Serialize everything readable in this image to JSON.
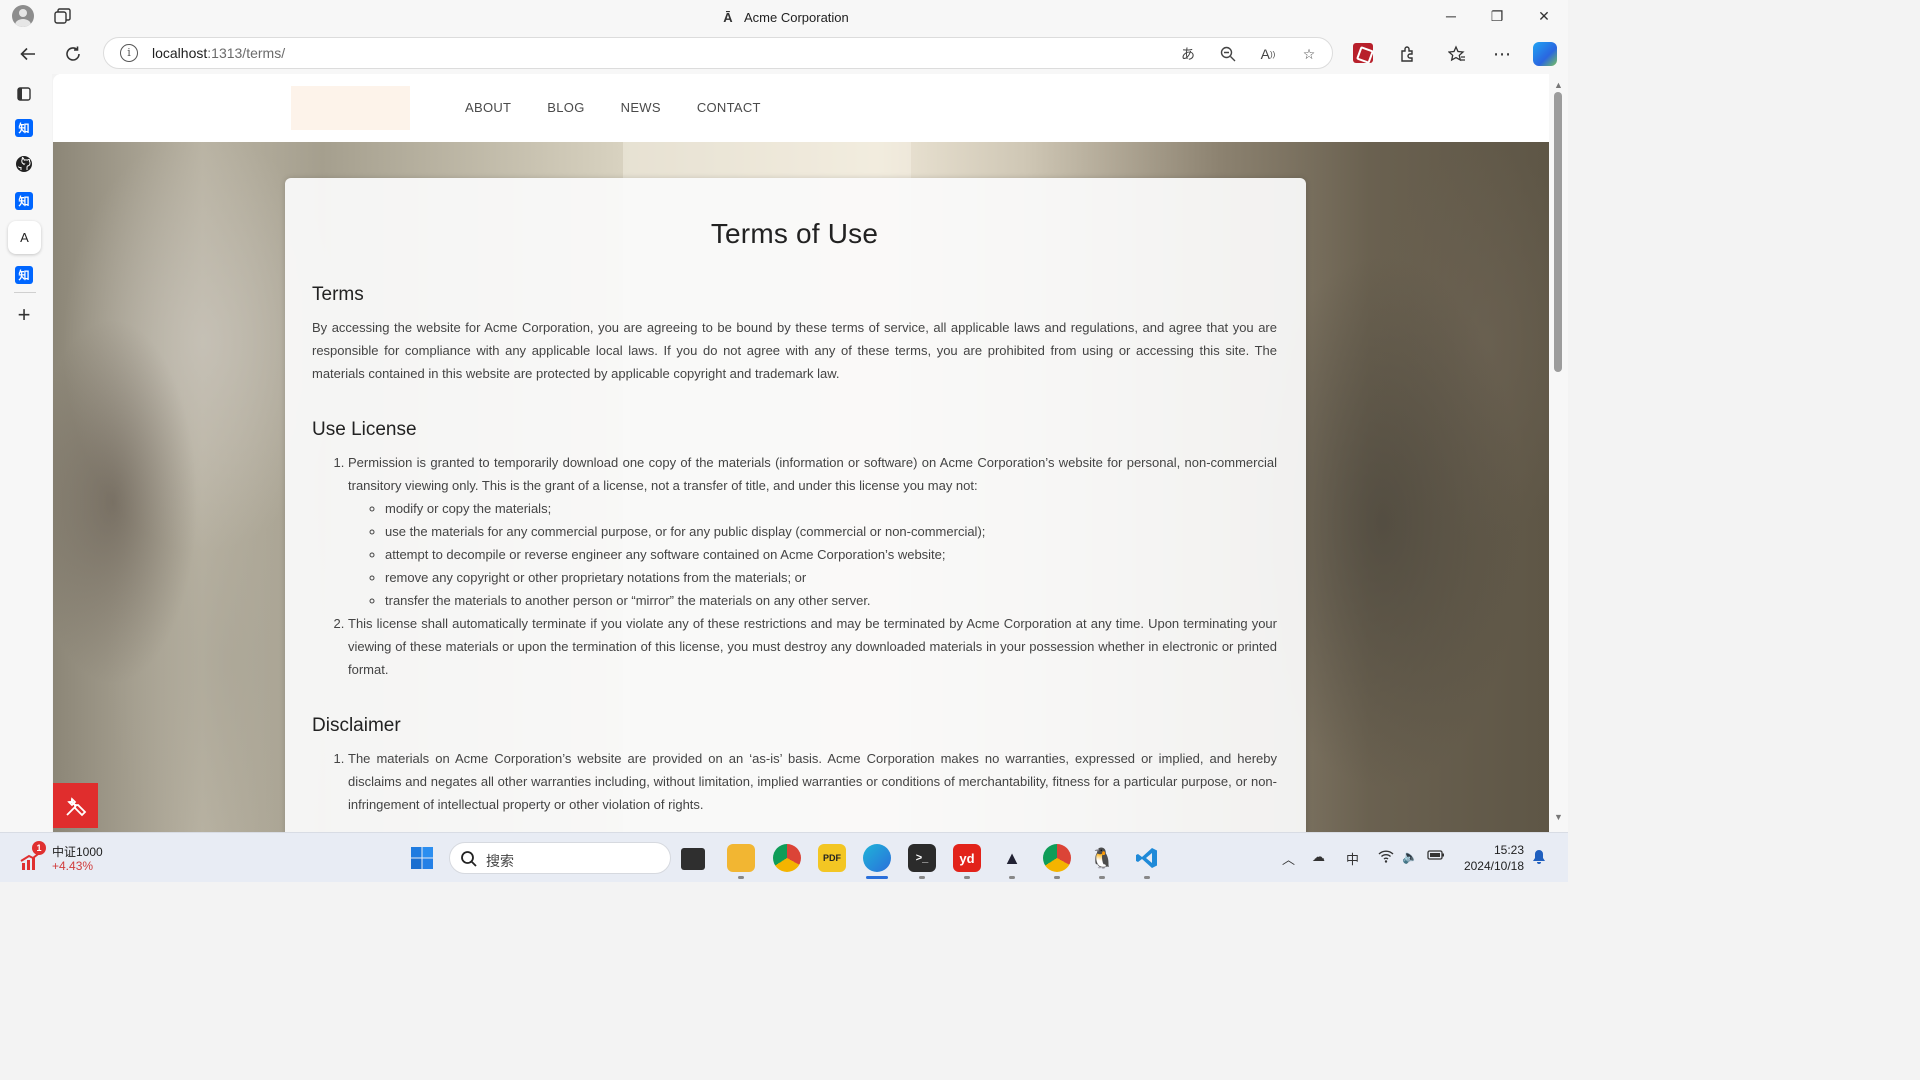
{
  "window": {
    "title": "Acme Corporation",
    "minimize_glyph": "─",
    "restore_glyph": "❐",
    "close_glyph": "✕"
  },
  "address_bar": {
    "host": "localhost",
    "path": ":1313/terms/"
  },
  "sidebar": {
    "items": [
      {
        "icon": "tabs-icon"
      },
      {
        "icon": "zhihu-icon",
        "label": "知"
      },
      {
        "icon": "github-icon"
      },
      {
        "icon": "zhihu-icon",
        "label": "知"
      },
      {
        "icon": "translate-icon",
        "label": "A"
      },
      {
        "icon": "zhihu-icon",
        "label": "知"
      },
      {
        "icon": "add-icon",
        "label": "+"
      }
    ]
  },
  "site": {
    "nav": [
      "ABOUT",
      "BLOG",
      "NEWS",
      "CONTACT"
    ],
    "title": "Terms of Use",
    "sections": {
      "terms": {
        "heading": "Terms",
        "body": "By accessing the website for Acme Corporation, you are agreeing to be bound by these terms of service, all applicable laws and regulations, and agree that you are responsible for compliance with any applicable local laws. If you do not agree with any of these terms, you are prohibited from using or accessing this site. The materials contained in this website are protected by applicable copyright and trademark law."
      },
      "license": {
        "heading": "Use License",
        "item1": "Permission is granted to temporarily download one copy of the materials (information or software) on Acme Corporation’s website for personal, non-commercial transitory viewing only. This is the grant of a license, not a transfer of title, and under this license you may not:",
        "sub": [
          "modify or copy the materials;",
          "use the materials for any commercial purpose, or for any public display (commercial or non-commercial);",
          "attempt to decompile or reverse engineer any software contained on Acme Corporation’s website;",
          "remove any copyright or other proprietary notations from the materials; or",
          "transfer the materials to another person or “mirror” the materials on any other server."
        ],
        "item2": "This license shall automatically terminate if you violate any of these restrictions and may be terminated by Acme Corporation at any time. Upon terminating your viewing of these materials or upon the termination of this license, you must destroy any downloaded materials in your possession whether in electronic or printed format."
      },
      "disclaimer": {
        "heading": "Disclaimer",
        "item1": "The materials on Acme Corporation’s website are provided on an ‘as-is’ basis. Acme Corporation makes no warranties, expressed or implied, and hereby disclaims and negates all other warranties including, without limitation, implied warranties or conditions of merchantability, fitness for a particular purpose, or non-infringement of intellectual property or other violation of rights."
      }
    }
  },
  "taskbar": {
    "stock_badge": "1",
    "stock_name": "中证1000",
    "stock_change": "+4.43%",
    "search_placeholder": "搜索",
    "tray_ime": "中",
    "time": "15:23",
    "date": "2024/10/18"
  },
  "colors": {
    "stock_up": "#d13c3c",
    "fab": "#e02d2d"
  }
}
